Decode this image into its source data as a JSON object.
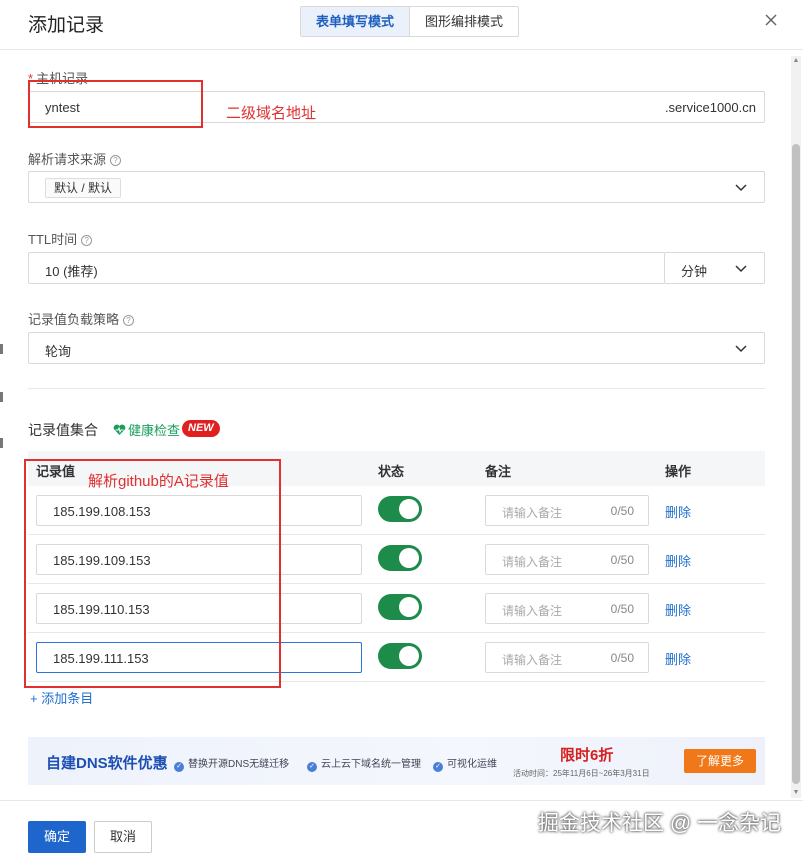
{
  "dialog": {
    "title": "添加记录",
    "mode_tabs": [
      "表单填写模式",
      "图形编排模式"
    ]
  },
  "host_record": {
    "label": "主机记录",
    "required_mark": "*",
    "value": "yntest",
    "suffix": ".service1000.cn"
  },
  "resolve_source": {
    "label": "解析请求来源",
    "value": "默认 / 默认"
  },
  "ttl": {
    "label": "TTL时间",
    "value": "10 (推荐)",
    "unit": "分钟"
  },
  "load_policy": {
    "label": "记录值负载策略",
    "value": "轮询"
  },
  "record_set": {
    "title": "记录值集合",
    "health_check": "健康检查",
    "new_badge": "NEW",
    "columns": [
      "记录值",
      "状态",
      "备注",
      "操作"
    ],
    "rows": [
      {
        "value": "185.199.108.153",
        "enabled": true,
        "note_placeholder": "请输入备注",
        "note_count": "0/50",
        "action": "删除"
      },
      {
        "value": "185.199.109.153",
        "enabled": true,
        "note_placeholder": "请输入备注",
        "note_count": "0/50",
        "action": "删除"
      },
      {
        "value": "185.199.110.153",
        "enabled": true,
        "note_placeholder": "请输入备注",
        "note_count": "0/50",
        "action": "删除"
      },
      {
        "value": "185.199.111.153",
        "enabled": true,
        "note_placeholder": "请输入备注",
        "note_count": "0/50",
        "action": "删除"
      }
    ],
    "add_item": "添加条目"
  },
  "banner": {
    "title": "自建DNS软件优惠",
    "features": [
      "替换开源DNS无缝迁移",
      "云上云下域名统一管理",
      "可视化运维"
    ],
    "promo": "限时6折",
    "date": "活动时间：25年11月6日~26年3月31日",
    "button": "了解更多"
  },
  "footer": {
    "confirm": "确定",
    "cancel": "取消",
    "watermark": "掘金技术社区 @ 一念杂记"
  },
  "annotations": {
    "host": "二级域名地址",
    "records": "解析github的A记录值"
  },
  "colors": {
    "primary": "#1f66cc",
    "toggle_on": "#1d8b4a",
    "annotation": "#e03030",
    "link": "#1f6fd0"
  }
}
